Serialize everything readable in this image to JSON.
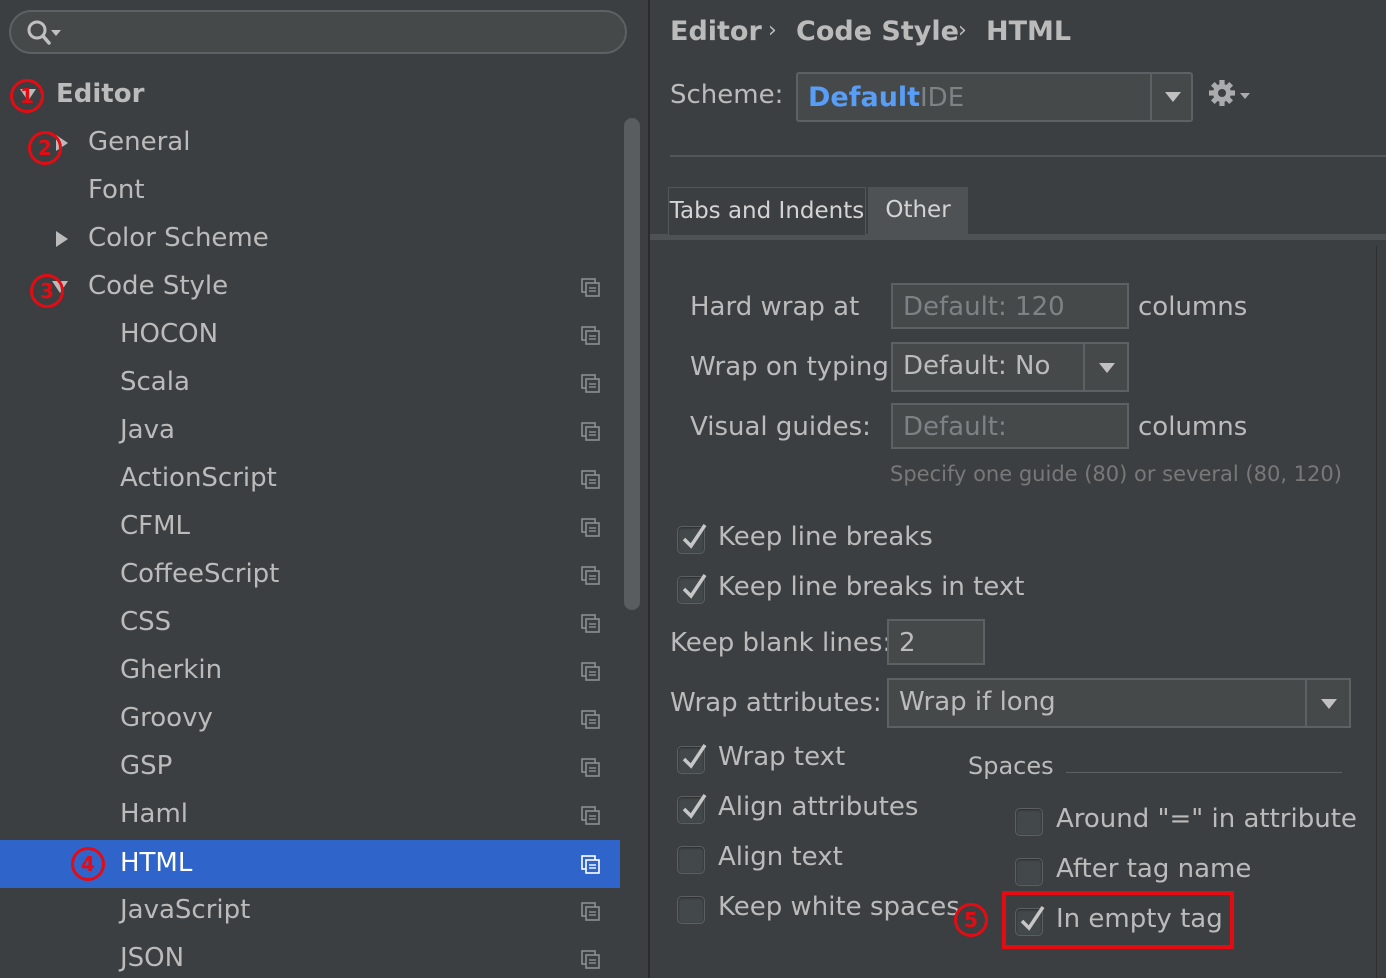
{
  "breadcrumb": {
    "items": [
      "Editor",
      "Code Style",
      "HTML"
    ],
    "separator": "›"
  },
  "scheme": {
    "label": "Scheme:",
    "name": "Default",
    "type": "IDE"
  },
  "tabs": [
    {
      "label": "Tabs and Indents",
      "active": false
    },
    {
      "label": "Other",
      "active": true
    }
  ],
  "sidebar": {
    "tree": [
      {
        "label": "Editor",
        "level": 0,
        "expanded": true,
        "badge": "1"
      },
      {
        "label": "General",
        "level": 1,
        "expanded": false,
        "badge": "2"
      },
      {
        "label": "Font",
        "level": 1
      },
      {
        "label": "Color Scheme",
        "level": 1,
        "expanded": false
      },
      {
        "label": "Code Style",
        "level": 1,
        "expanded": true,
        "badge": "3"
      },
      {
        "label": "HOCON",
        "level": 2
      },
      {
        "label": "Scala",
        "level": 2
      },
      {
        "label": "Java",
        "level": 2
      },
      {
        "label": "ActionScript",
        "level": 2
      },
      {
        "label": "CFML",
        "level": 2
      },
      {
        "label": "CoffeeScript",
        "level": 2
      },
      {
        "label": "CSS",
        "level": 2
      },
      {
        "label": "Gherkin",
        "level": 2
      },
      {
        "label": "Groovy",
        "level": 2
      },
      {
        "label": "GSP",
        "level": 2
      },
      {
        "label": "Haml",
        "level": 2
      },
      {
        "label": "HTML",
        "level": 2,
        "selected": true,
        "badge": "4"
      },
      {
        "label": "JavaScript",
        "level": 2
      },
      {
        "label": "JSON",
        "level": 2
      }
    ]
  },
  "form": {
    "hard_wrap": {
      "label": "Hard wrap at",
      "placeholder": "Default: 120",
      "suffix": "columns"
    },
    "wrap_on_typing": {
      "label": "Wrap on typing",
      "value": "Default: No"
    },
    "visual_guides": {
      "label": "Visual guides:",
      "placeholder": "Default:",
      "suffix": "columns",
      "hint": "Specify one guide (80) or several (80, 120)"
    },
    "keep_line_breaks": {
      "label": "Keep line breaks",
      "checked": true
    },
    "keep_line_breaks_text": {
      "label": "Keep line breaks in text",
      "checked": true
    },
    "keep_blank_lines": {
      "label": "Keep blank lines:",
      "value": "2"
    },
    "wrap_attributes": {
      "label": "Wrap attributes:",
      "value": "Wrap if long"
    },
    "wrap_text": {
      "label": "Wrap text",
      "checked": true
    },
    "align_attributes": {
      "label": "Align attributes",
      "checked": true
    },
    "align_text": {
      "label": "Align text",
      "checked": false
    },
    "keep_white_spaces": {
      "label": "Keep white spaces",
      "checked": false
    }
  },
  "spaces": {
    "title": "Spaces",
    "around_eq": {
      "label": "Around \"=\" in attribute",
      "checked": false
    },
    "after_tag_name": {
      "label": "After tag name",
      "checked": false
    },
    "in_empty_tag": {
      "label": "In empty tag",
      "checked": true,
      "badge": "5"
    }
  },
  "colors": {
    "accent": "#2f65ca",
    "annotation": "#e50b13",
    "link": "#589df6",
    "background": "#3c3f41"
  },
  "icons": [
    "search-icon",
    "expand-arrow-icon",
    "collapse-arrow-icon",
    "copy-icon",
    "dropdown-arrow-icon",
    "gear-icon",
    "checkmark-icon"
  ]
}
